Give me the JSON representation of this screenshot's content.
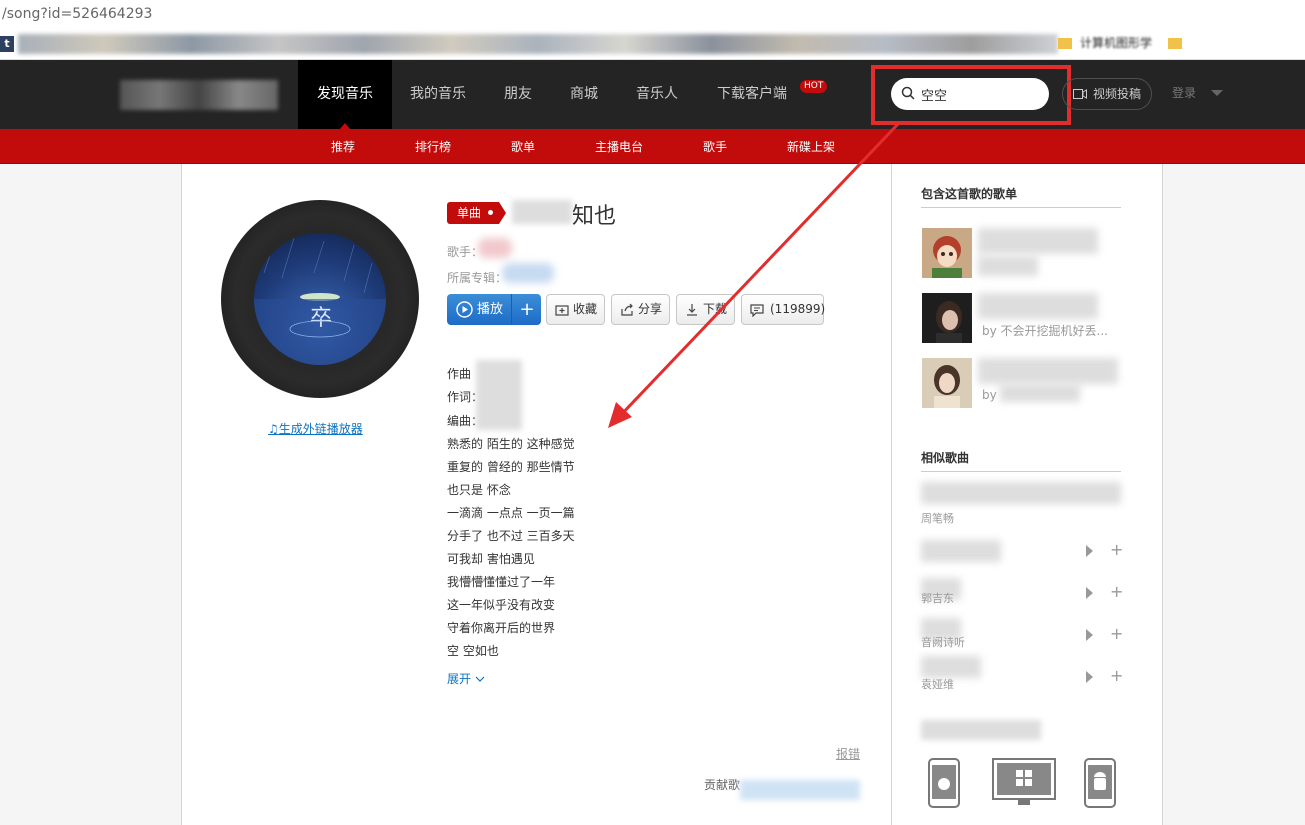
{
  "browser": {
    "address_fragment": "/song?id=526464293",
    "bookmark_t": "t",
    "bookmark_label": "计算机图形学"
  },
  "topnav": {
    "items": [
      "发现音乐",
      "我的音乐",
      "朋友",
      "商城",
      "音乐人",
      "下载客户端"
    ],
    "hot_badge": "HOT",
    "search_value": "空空",
    "upload_label": "视频投稿",
    "login_label": "登录"
  },
  "subnav": {
    "items": [
      "推荐",
      "排行榜",
      "歌单",
      "主播电台",
      "歌手",
      "新碟上架"
    ]
  },
  "song": {
    "tag": "单曲",
    "title_visible": "知也",
    "artist_label": "歌手：",
    "album_label": "所属专辑：",
    "player_link": "生成外链播放器",
    "buttons": {
      "play": "播放",
      "add": "+",
      "collect": "收藏",
      "share": "分享",
      "download": "下载",
      "comments": "(119899)"
    }
  },
  "lyrics": {
    "credits": [
      "作曲",
      "作词：",
      "编曲："
    ],
    "lines": [
      "熟悉的 陌生的 这种感觉",
      "重复的 曾经的 那些情节",
      "也只是 怀念",
      "一滴滴 一点点 一页一篇",
      "分手了 也不过 三百多天",
      "可我却 害怕遇见",
      "我懵懵懂懂过了一年",
      "这一年似乎没有改变",
      "守着你离开后的世界",
      "空 空如也"
    ],
    "expand": "展开"
  },
  "footer": {
    "report": "报错",
    "contributor_label": "贡献歌"
  },
  "sidebar": {
    "playlists_title": "包含这首歌的歌单",
    "playlists": [
      {
        "by": ""
      },
      {
        "by": "by  不会开挖掘机好丢..."
      },
      {
        "by": "by"
      }
    ],
    "similar_title": "相似歌曲",
    "similar": [
      {
        "artist": "周笔畅"
      },
      {
        "artist": ""
      },
      {
        "artist": "郭吉东"
      },
      {
        "artist": "音阙诗听"
      },
      {
        "artist": "袁娅维"
      }
    ]
  },
  "colors": {
    "brand_red": "#c20c0c",
    "topbar": "#242424",
    "play_blue": "#2a7fd2",
    "annotation_red": "#e32d2d"
  }
}
